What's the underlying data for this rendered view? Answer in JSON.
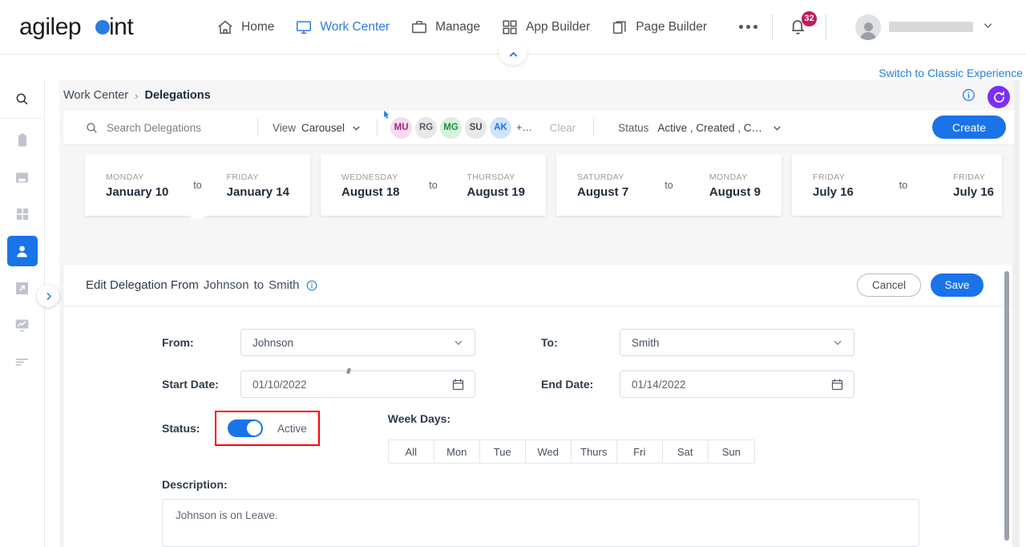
{
  "topnav": {
    "logo_text": "agilepoint",
    "items": [
      {
        "label": "Home",
        "icon": "home-icon",
        "active": false
      },
      {
        "label": "Work Center",
        "icon": "monitor-icon",
        "active": true
      },
      {
        "label": "Manage",
        "icon": "briefcase-icon",
        "active": false
      },
      {
        "label": "App Builder",
        "icon": "grid-icon",
        "active": false
      },
      {
        "label": "Page Builder",
        "icon": "pages-icon",
        "active": false
      }
    ],
    "more_label": "•••",
    "notification_count": "32",
    "user_name_masked": ""
  },
  "page": {
    "switch_classic_label": "Switch to Classic Experience"
  },
  "sidebar": {
    "items": [
      {
        "name": "search-icon"
      },
      {
        "name": "clipboard-icon"
      },
      {
        "name": "inbox-icon"
      },
      {
        "name": "apps-grid-icon"
      },
      {
        "name": "user-icon",
        "selected": true
      },
      {
        "name": "share-export-icon"
      },
      {
        "name": "reports-icon"
      },
      {
        "name": "list-icon"
      }
    ],
    "expand_label": "›"
  },
  "breadcrumb": {
    "root": "Work Center",
    "separator": "›",
    "current": "Delegations"
  },
  "toolbar": {
    "search_placeholder": "Search Delegations",
    "search_value": "",
    "view_label": "View",
    "view_value": "Carousel",
    "chips": [
      {
        "initials": "MU",
        "bg": "#f6dcec",
        "fg": "#a0247e"
      },
      {
        "initials": "RG",
        "bg": "#e8e8e8",
        "fg": "#55606c"
      },
      {
        "initials": "MG",
        "bg": "#d9f0dd",
        "fg": "#1e8e3e"
      },
      {
        "initials": "SU",
        "bg": "#e8e8e8",
        "fg": "#3f4a5a"
      },
      {
        "initials": "AK",
        "bg": "#cfe4fb",
        "fg": "#1a73e8"
      }
    ],
    "chip_more": "+…",
    "clear_label": "Clear",
    "status_label": "Status",
    "status_value": "Active , Created , C…",
    "create_label": "Create"
  },
  "carousel": {
    "to_label": "to",
    "cards": [
      {
        "start_dow": "MONDAY",
        "start_date": "January 10",
        "end_dow": "FRIDAY",
        "end_date": "January 14",
        "selected": true
      },
      {
        "start_dow": "WEDNESDAY",
        "start_date": "August 18",
        "end_dow": "THURSDAY",
        "end_date": "August 19",
        "selected": false
      },
      {
        "start_dow": "SATURDAY",
        "start_date": "August 7",
        "end_dow": "MONDAY",
        "end_date": "August 9",
        "selected": false
      },
      {
        "start_dow": "FRIDAY",
        "start_date": "July 16",
        "end_dow": "FRIDAY",
        "end_date": "July 16",
        "selected": false
      }
    ]
  },
  "detail": {
    "title_prefix": "Edit Delegation From",
    "title_from": "Johnson",
    "title_to_word": "to",
    "title_to": "Smith",
    "cancel_label": "Cancel",
    "save_label": "Save",
    "fields": {
      "from_label": "From:",
      "from_value": "Johnson",
      "to_label": "To:",
      "to_value": "Smith",
      "start_date_label": "Start Date:",
      "start_date_value": "01/10/2022",
      "end_date_label": "End Date:",
      "end_date_value": "01/14/2022",
      "status_label": "Status:",
      "status_toggle_state": "Active",
      "week_days_label": "Week Days:",
      "week_days": [
        "All",
        "Mon",
        "Tue",
        "Wed",
        "Thurs",
        "Fri",
        "Sat",
        "Sun"
      ],
      "description_label": "Description:",
      "description_value": "Johnson is on Leave."
    }
  },
  "colors": {
    "accent_blue": "#1a73e8",
    "link_blue": "#2a7de1",
    "refresh_purple": "#7b2ff7",
    "badge_pink": "#c2185b",
    "highlight_red": "#ff0000"
  }
}
